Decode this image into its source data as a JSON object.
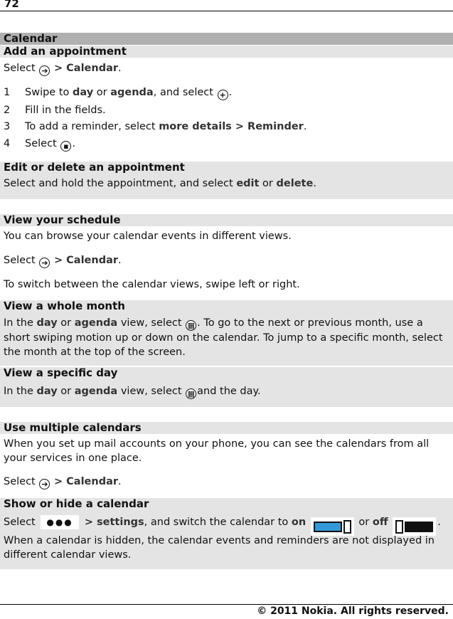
{
  "page": {
    "number": "72",
    "copyright": "© 2011 Nokia. All rights reserved."
  },
  "chapter": {
    "title": "Calendar"
  },
  "add": {
    "title": "Add an appointment",
    "select_prefix": "Select",
    "select_target": "> Calendar",
    "select_icon": "arrow-right-circle-icon",
    "steps": [
      {
        "n": "1",
        "t1": "Swipe to ",
        "b1": "day",
        "t2": " or ",
        "b2": "agenda",
        "t3": ", and select",
        "icon": "plus-circle-icon",
        "end": "."
      },
      {
        "n": "2",
        "text": "Fill in the fields."
      },
      {
        "n": "3",
        "t1": "To add a reminder, select ",
        "b1": "more details",
        "t2": "  > ",
        "b2": "Reminder",
        "end": "."
      },
      {
        "n": "4",
        "t1": "Select",
        "icon": "save-circle-icon",
        "end": "."
      }
    ]
  },
  "edit": {
    "title": "Edit or delete an appointment",
    "t1": "Select and hold the appointment, and select ",
    "b1": "edit",
    "t2": " or ",
    "b2": "delete",
    "end": "."
  },
  "schedule": {
    "title": "View your schedule",
    "intro": "You can browse your calendar events in different views.",
    "select_prefix": "Select",
    "select_target": "> Calendar",
    "switch_text": "To switch between the calendar views, swipe left or right."
  },
  "month": {
    "title": "View a whole month",
    "t1": "In the ",
    "b1": "day",
    "t2": " or ",
    "b2": "agenda",
    "t3": " view, select",
    "t4": ". To go to the next or previous month, use a short swiping motion up or down on the calendar. To jump to a specific month, select the month at the top of the screen."
  },
  "day": {
    "title": "View a specific day",
    "t1": "In the ",
    "b1": "day",
    "t2": " or ",
    "b2": "agenda",
    "t3": " view, select",
    "t4": "and the day."
  },
  "multi": {
    "title": "Use multiple calendars",
    "intro": "When you set up mail accounts on your phone, you can see the calendars from all your services in one place.",
    "select_prefix": "Select",
    "select_target": "> Calendar"
  },
  "showhide": {
    "title": "Show or hide a calendar",
    "t1": "Select",
    "dots": "●●●",
    "t2": " > ",
    "b1": "settings",
    "t3": ", and switch the calendar to ",
    "b2": "on",
    "t4": " or ",
    "b3": "off",
    "end": ".",
    "note": "When a calendar is hidden, the calendar events and reminders are not displayed in different calendar views.",
    "on_color": "#3399d6"
  }
}
